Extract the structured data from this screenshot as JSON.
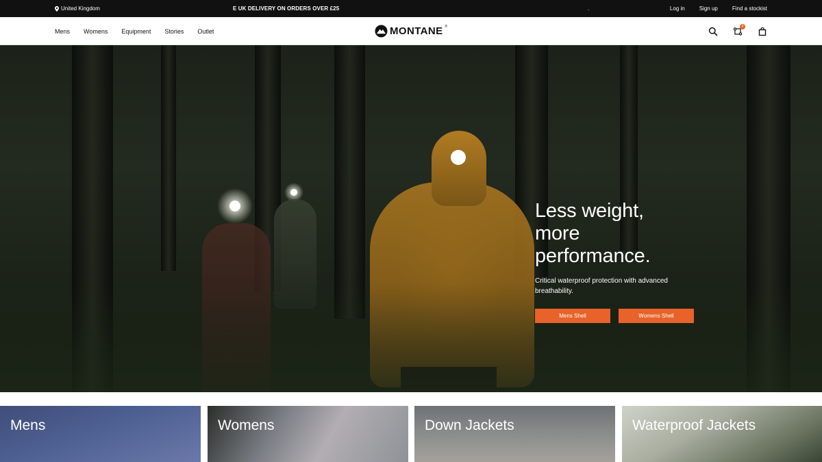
{
  "topbar": {
    "region": "United Kingdom",
    "promo": "E UK DELIVERY ON ORDERS OVER £25",
    "dot": ".",
    "links": [
      "Log in",
      "Sign up",
      "Find a stockist"
    ]
  },
  "nav": {
    "menu": [
      "Mens",
      "Womens",
      "Equipment",
      "Stories",
      "Outlet"
    ],
    "logo": "MONTANE",
    "logo_reg": "®",
    "compare_badge": "0",
    "icons": [
      "search-icon",
      "compare-icon",
      "bag-icon"
    ]
  },
  "hero": {
    "headline_line1": "Less weight,",
    "headline_line2": "more",
    "headline_line3": "performance.",
    "subtext": "Critical waterproof protection with advanced breathability.",
    "cta_primary": "Mens Shell",
    "cta_secondary": "Womens Shell"
  },
  "tiles": [
    "Mens",
    "Womens",
    "Down Jackets",
    "Waterproof Jackets"
  ],
  "colors": {
    "accent": "#e8622a",
    "topbar_bg": "#111111"
  }
}
